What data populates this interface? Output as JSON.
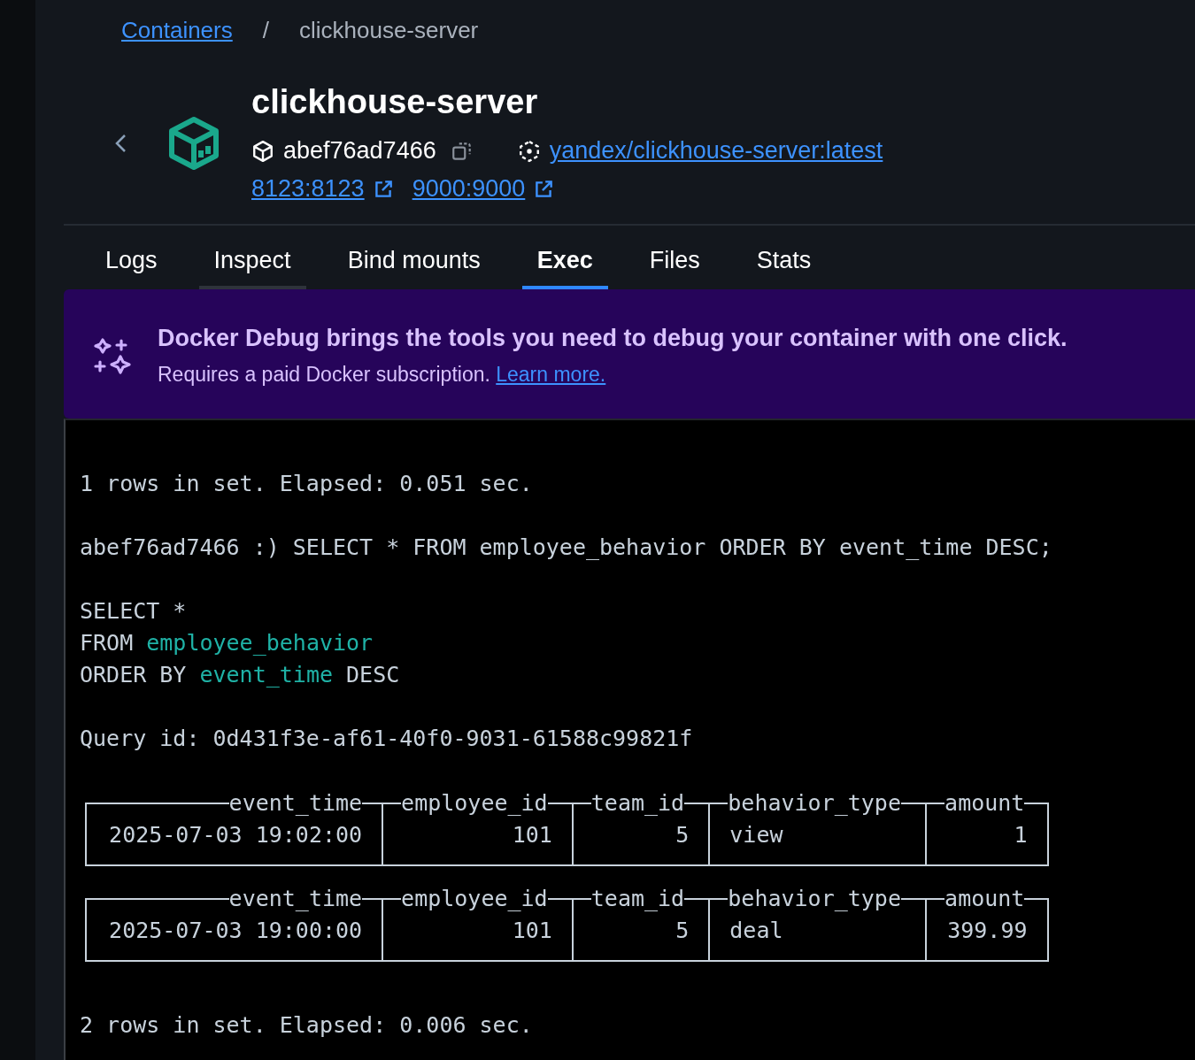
{
  "breadcrumb": {
    "parent": "Containers",
    "separator": "/",
    "current": "clickhouse-server"
  },
  "container": {
    "name": "clickhouse-server",
    "id": "abef76ad7466",
    "image": "yandex/clickhouse-server:latest",
    "ports": [
      "8123:8123",
      "9000:9000"
    ]
  },
  "tabs": [
    {
      "label": "Logs",
      "selected": false,
      "hovered": false
    },
    {
      "label": "Inspect",
      "selected": false,
      "hovered": true
    },
    {
      "label": "Bind mounts",
      "selected": false,
      "hovered": false
    },
    {
      "label": "Exec",
      "selected": true,
      "hovered": false
    },
    {
      "label": "Files",
      "selected": false,
      "hovered": false
    },
    {
      "label": "Stats",
      "selected": false,
      "hovered": false
    }
  ],
  "banner": {
    "title": "Docker Debug brings the tools you need to debug your container with one click.",
    "text": "Requires a paid Docker subscription.",
    "link": "Learn more."
  },
  "terminal": [
    {
      "kind": "blank"
    },
    {
      "kind": "text",
      "parts": [
        {
          "text": "1 rows in set. Elapsed: 0.051 sec.",
          "identifier": false
        }
      ]
    },
    {
      "kind": "blank"
    },
    {
      "kind": "text",
      "parts": [
        {
          "text": "abef76ad7466 :) SELECT * FROM employee_behavior ORDER BY event_time DESC;",
          "identifier": false
        }
      ]
    },
    {
      "kind": "blank"
    },
    {
      "kind": "text",
      "parts": [
        {
          "text": "SELECT *",
          "identifier": false
        }
      ]
    },
    {
      "kind": "text",
      "parts": [
        {
          "text": "FROM ",
          "identifier": false
        },
        {
          "text": "employee_behavior",
          "identifier": true
        }
      ]
    },
    {
      "kind": "text",
      "parts": [
        {
          "text": "ORDER BY ",
          "identifier": false
        },
        {
          "text": "event_time",
          "identifier": true
        },
        {
          "text": " DESC",
          "identifier": false
        }
      ]
    },
    {
      "kind": "blank"
    },
    {
      "kind": "text",
      "parts": [
        {
          "text": "Query id: 0d431f3e-af61-40f0-9031-61588c99821f",
          "identifier": false
        }
      ]
    },
    {
      "kind": "blank"
    },
    {
      "kind": "table",
      "columns": [
        {
          "name": "event_time",
          "kind": "datetime"
        },
        {
          "name": "employee_id",
          "kind": "number"
        },
        {
          "name": "team_id",
          "kind": "number"
        },
        {
          "name": "behavior_type",
          "kind": "text"
        },
        {
          "name": "amount",
          "kind": "number"
        }
      ],
      "row": [
        "2025-07-03 19:02:00",
        "101",
        "5",
        "view",
        "1"
      ]
    },
    {
      "kind": "table",
      "columns": [
        {
          "name": "event_time",
          "kind": "datetime"
        },
        {
          "name": "employee_id",
          "kind": "number"
        },
        {
          "name": "team_id",
          "kind": "number"
        },
        {
          "name": "behavior_type",
          "kind": "text"
        },
        {
          "name": "amount",
          "kind": "number"
        }
      ],
      "row": [
        "2025-07-03 19:00:00",
        "101",
        "5",
        "deal",
        "399.99"
      ]
    },
    {
      "kind": "blank"
    },
    {
      "kind": "text",
      "parts": [
        {
          "text": "2 rows in set. Elapsed: 0.006 sec.",
          "identifier": false
        }
      ]
    }
  ]
}
